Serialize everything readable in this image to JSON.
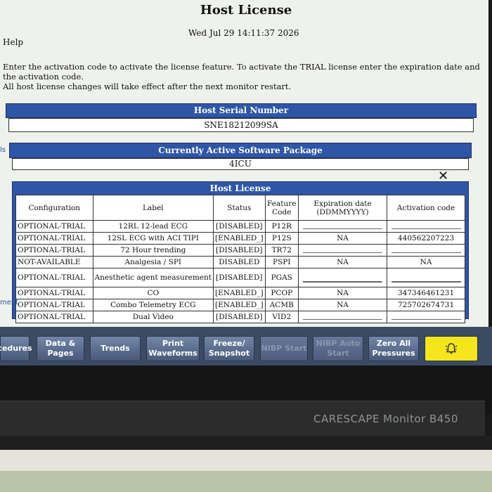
{
  "header": {
    "title": "Host License",
    "datetime": "Wed Jul 29 14:11:37 2026",
    "help_label": "Help"
  },
  "instructions": [
    "Enter the activation code to activate the license feature. To activate the TRIAL license enter the expiration date and",
    "the activation code.",
    "All host license changes will take effect after the next monitor restart."
  ],
  "serial": {
    "heading": "Host Serial Number",
    "value": "SNE18212099SA"
  },
  "software": {
    "heading": "Currently Active Software Package",
    "value": "4ICU"
  },
  "edge_labels": {
    "left_top": "ls",
    "left_bottom": "ment"
  },
  "close_glyph": "✕",
  "license_table": {
    "title": "Host License",
    "columns": [
      "Configuration",
      "Label",
      "Status",
      "Feature Code",
      "Expiration date (DDMMYYYY)",
      "Activation code"
    ],
    "rows": [
      {
        "configuration": "OPTIONAL-TRIAL",
        "label": "12RL 12-lead ECG",
        "status": "[DISABLED]",
        "code": "P12R",
        "expiration": "",
        "activation": ""
      },
      {
        "configuration": "OPTIONAL-TRIAL",
        "label": "12SL ECG with ACI TIPI",
        "status": "[ENABLED_]",
        "code": "P12S",
        "expiration": "NA",
        "activation": "440562207223"
      },
      {
        "configuration": "OPTIONAL-TRIAL",
        "label": "72 Hour trending",
        "status": "[DISABLED]",
        "code": "TR72",
        "expiration": "",
        "activation": ""
      },
      {
        "configuration": "NOT-AVAILABLE",
        "label": "Analgesia / SPI",
        "status": "DISABLED",
        "code": "PSPI",
        "expiration": "NA",
        "activation": "NA"
      },
      {
        "configuration": "OPTIONAL-TRIAL",
        "label": "Anesthetic agent measurement",
        "status": "[DISABLED]",
        "code": "PGAS",
        "expiration": "",
        "activation": ""
      },
      {
        "configuration": "OPTIONAL-TRIAL",
        "label": "CO",
        "status": "[ENABLED_]",
        "code": "PCOP",
        "expiration": "NA",
        "activation": "347346461231"
      },
      {
        "configuration": "OPTIONAL-TRIAL",
        "label": "Combo Telemetry ECG",
        "status": "[ENABLED_]",
        "code": "ACMB",
        "expiration": "NA",
        "activation": "725702674731"
      },
      {
        "configuration": "OPTIONAL-TRIAL",
        "label": "Dual Video",
        "status": "[DISABLED]",
        "code": "VID2",
        "expiration": "",
        "activation": ""
      }
    ]
  },
  "tabs": {
    "procedures": "cedures",
    "data_pages": "Data & Pages",
    "trends": "Trends",
    "print_waveforms": "Print Waveforms",
    "freeze_snapshot": "Freeze/ Snapshot",
    "nibp_start": "NIBP Start",
    "nibp_auto_start": "NIBP Auto Start",
    "zero_all_pressures": "Zero All Pressures",
    "alarm_icon": "bell-icon"
  },
  "device": {
    "brand": "CARESCAPE Monitor B450"
  },
  "colors": {
    "panel_blue": "#2e56a8",
    "tab_blue": "#5c6f92",
    "alarm_yellow": "#f4e51d"
  }
}
